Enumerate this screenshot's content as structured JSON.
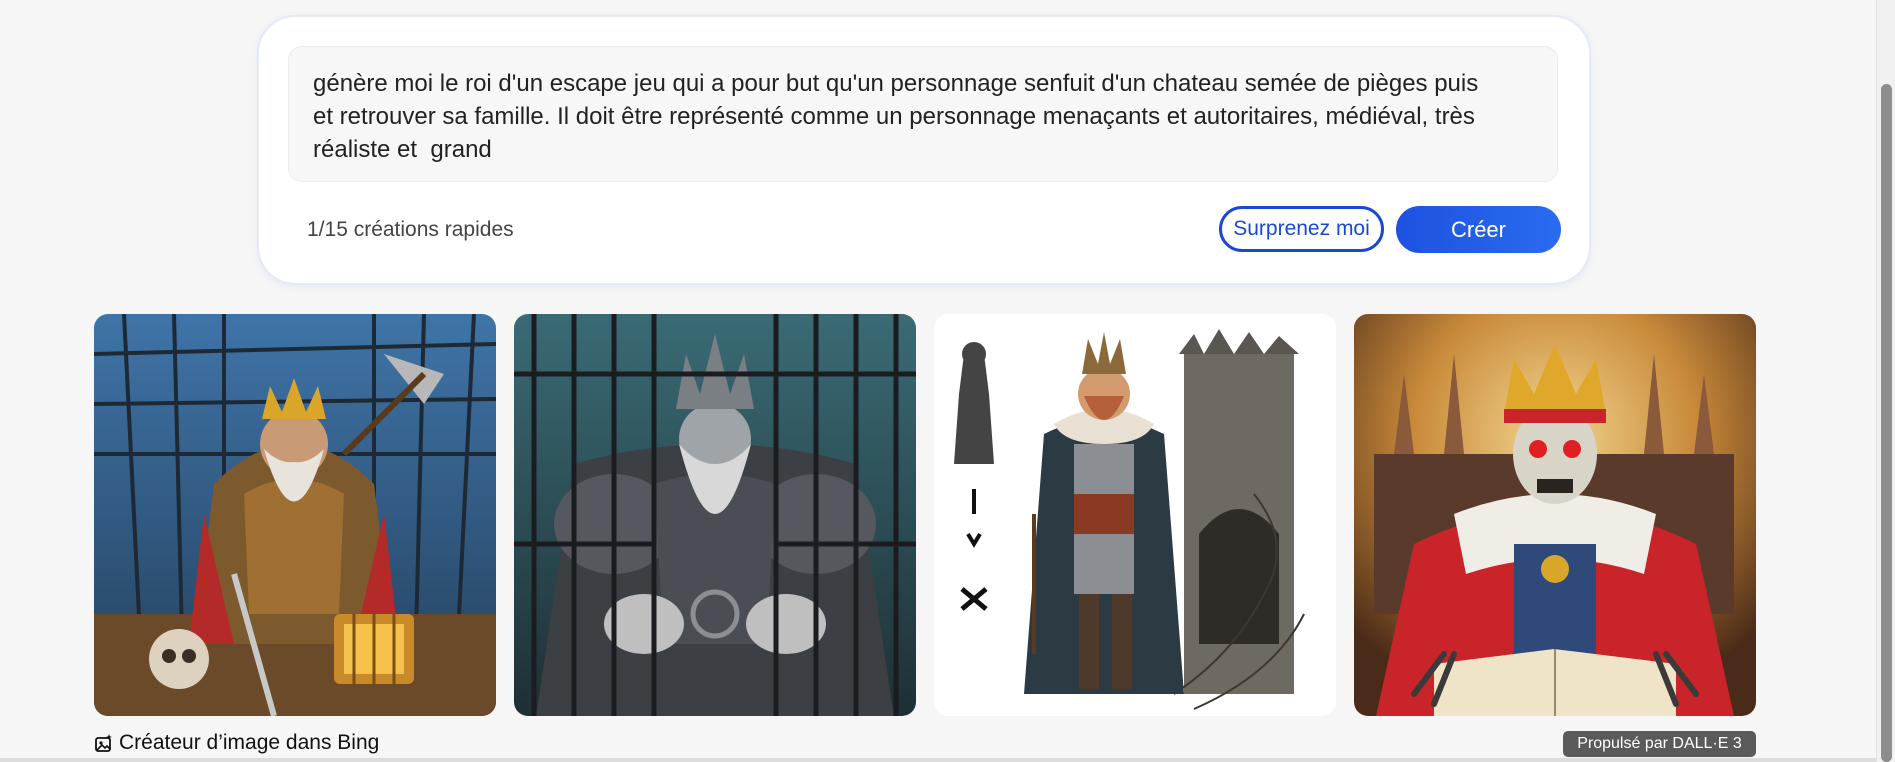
{
  "prompt": {
    "text": "génère moi le roi d'un escape jeu qui a pour but qu'un personnage senfuit d'un chateau semée de pièges puis\net retrouver sa famille. Il doit être représenté comme un personnage menaçants et autoritaires, médiéval, très\nréaliste et  grand",
    "quick_creations": "1/15 créations rapides",
    "surprise_label": "Surprenez moi",
    "create_label": "Créer"
  },
  "images": [
    {
      "icon": "bearded-king-in-cage-image"
    },
    {
      "icon": "armored-king-behind-bars-image"
    },
    {
      "icon": "king-with-castle-tower-image"
    },
    {
      "icon": "skeleton-king-with-book-image"
    }
  ],
  "footer": {
    "creator_label": "Créateur d’image dans Bing",
    "powered_by": "Propulsé par DALL·E 3"
  },
  "colors": {
    "accent": "#1a48d6",
    "background": "#f6f6f6"
  }
}
